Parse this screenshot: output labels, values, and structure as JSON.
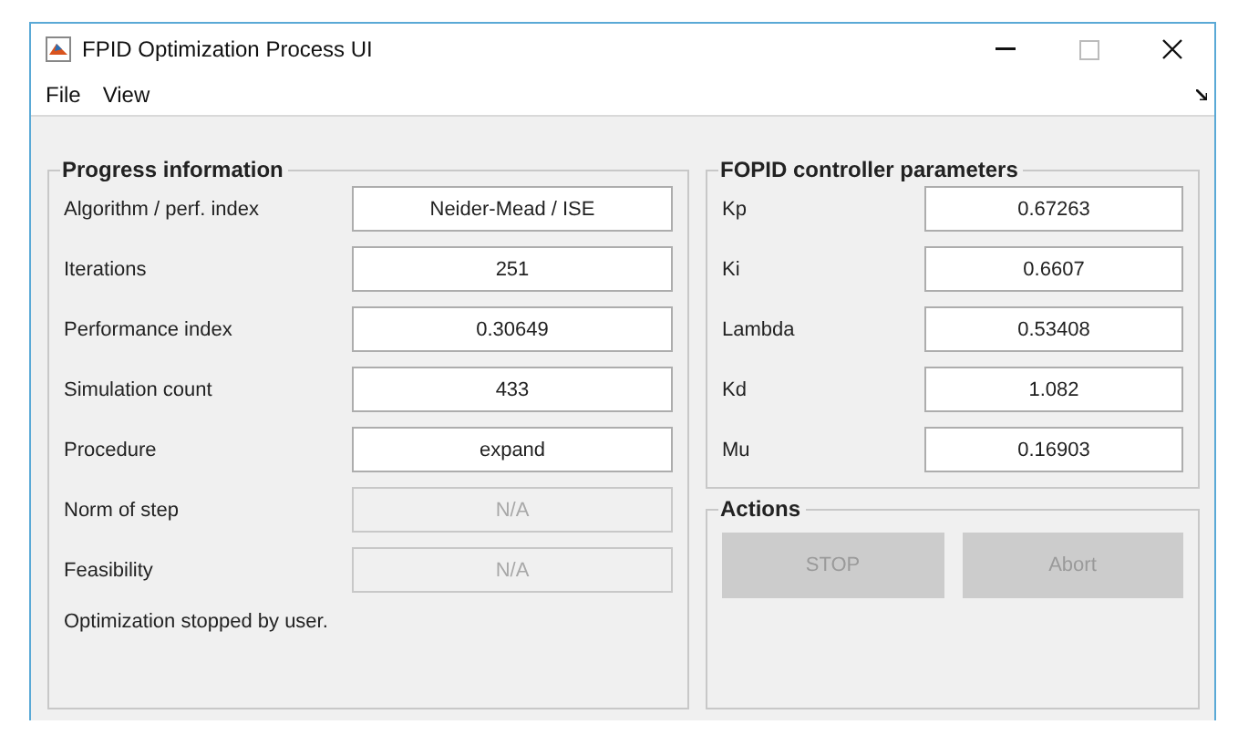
{
  "window": {
    "title": "FPID Optimization Process UI"
  },
  "menu": [
    "File",
    "View"
  ],
  "progress": {
    "title": "Progress information",
    "rows": [
      {
        "label": "Algorithm / perf. index",
        "value": "Neider-Mead / ISE",
        "disabled": false
      },
      {
        "label": "Iterations",
        "value": "251",
        "disabled": false
      },
      {
        "label": "Performance index",
        "value": "0.30649",
        "disabled": false
      },
      {
        "label": "Simulation count",
        "value": "433",
        "disabled": false
      },
      {
        "label": "Procedure",
        "value": "expand",
        "disabled": false
      },
      {
        "label": "Norm of step",
        "value": "N/A",
        "disabled": true
      },
      {
        "label": "Feasibility",
        "value": "N/A",
        "disabled": true
      }
    ],
    "status": "Optimization stopped by user."
  },
  "parameters": {
    "title": "FOPID controller parameters",
    "rows": [
      {
        "label": "Kp",
        "value": "0.67263"
      },
      {
        "label": "Ki",
        "value": "0.6607"
      },
      {
        "label": "Lambda",
        "value": "0.53408"
      },
      {
        "label": "Kd",
        "value": "1.082"
      },
      {
        "label": "Mu",
        "value": "0.16903"
      }
    ]
  },
  "actions": {
    "title": "Actions",
    "buttons": [
      {
        "label": "STOP",
        "disabled": true
      },
      {
        "label": "Abort",
        "disabled": true
      }
    ]
  }
}
